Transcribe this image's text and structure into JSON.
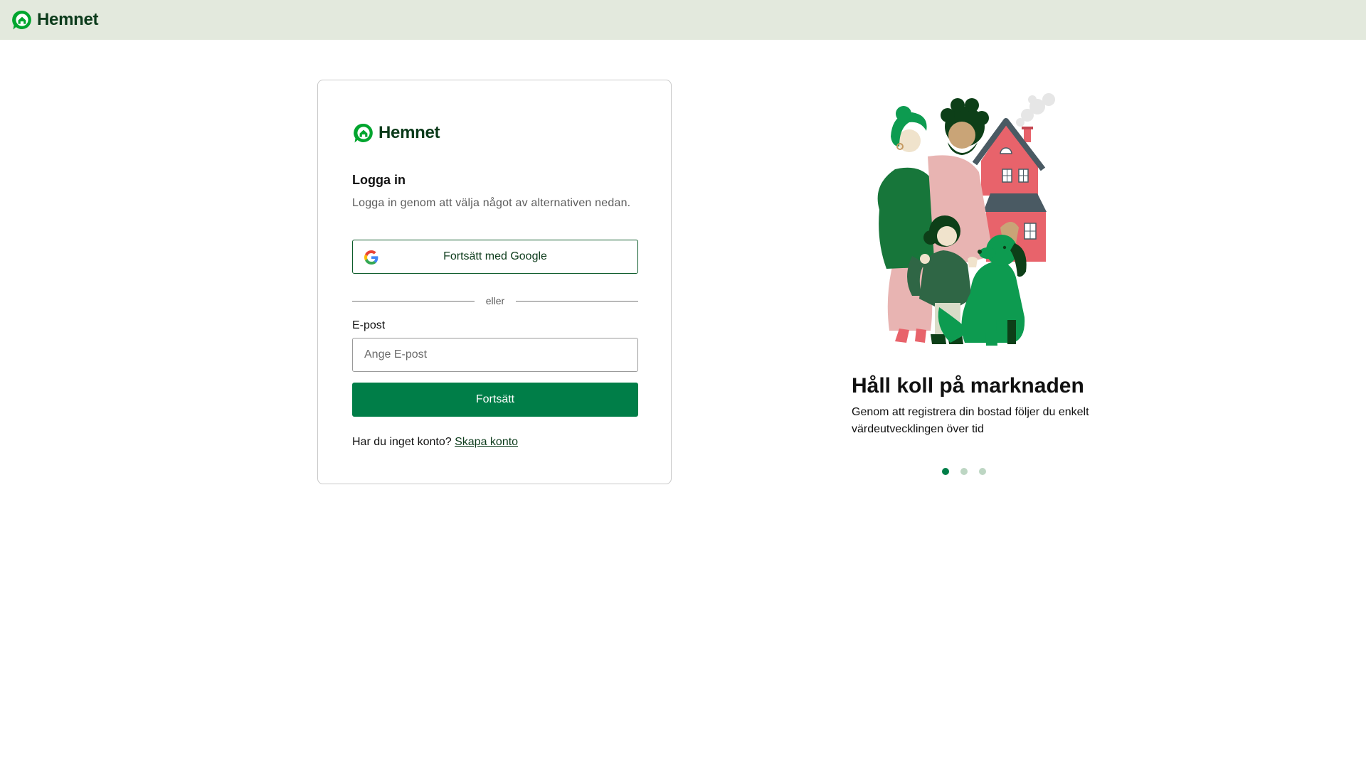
{
  "header": {
    "brand_name": "Hemnet",
    "logo_icon": "hemnet-logo-icon"
  },
  "login_card": {
    "brand_name": "Hemnet",
    "title": "Logga in",
    "subtitle": "Logga in genom att välja något av alternativen nedan.",
    "google_button_label": "Fortsätt med Google",
    "divider_text": "eller",
    "email_label": "E-post",
    "email_placeholder": "Ange E-post",
    "email_value": "",
    "continue_label": "Fortsätt",
    "no_account_text": "Har du inget konto?",
    "create_account_link": "Skapa konto"
  },
  "promo": {
    "illustration": "family-house-dog-illustration",
    "title": "Håll koll på marknaden",
    "text": "Genom att registrera din bostad följer du enkelt värdeutvecklingen över tid",
    "carousel": {
      "slide_count": 3,
      "active_index": 0
    }
  },
  "colors": {
    "header_bg": "#e3e9dd",
    "brand_green": "#00a52e",
    "dark_green": "#0c3b1b",
    "button_green": "#007e48",
    "dot_inactive": "#bdd6c3"
  }
}
